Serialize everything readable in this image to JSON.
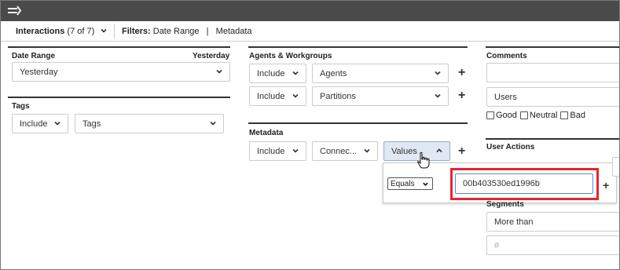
{
  "interactions": {
    "label": "Interactions",
    "count": "(7 of 7)"
  },
  "filters": {
    "label": "Filters:",
    "items": "Date Range",
    "separator": "|",
    "items2": "Metadata"
  },
  "date_range": {
    "title": "Date Range",
    "preset_label": "Yesterday",
    "value": "Yesterday"
  },
  "tags": {
    "title": "Tags",
    "include": "Include",
    "value": "Tags"
  },
  "agents_workgroups": {
    "title": "Agents & Workgroups",
    "rows": [
      {
        "include": "Include",
        "value": "Agents"
      },
      {
        "include": "Include",
        "value": "Partitions"
      }
    ]
  },
  "metadata": {
    "title": "Metadata",
    "include": "Include",
    "key": "Connec...",
    "values_button": "Values"
  },
  "popup": {
    "operator": "Equals",
    "value": "00b403530ed1996b"
  },
  "comments": {
    "title": "Comments",
    "value": "Users",
    "checks": [
      "Good",
      "Neutral",
      "Bad"
    ]
  },
  "user_actions": {
    "title": "User Actions"
  },
  "segments": {
    "title": "Segments",
    "value": "More than",
    "placeholder": "#"
  },
  "colors": {
    "topbar": "#4a4a4a",
    "highlight": "#e8242e",
    "values_bg": "#dfe8f3"
  }
}
